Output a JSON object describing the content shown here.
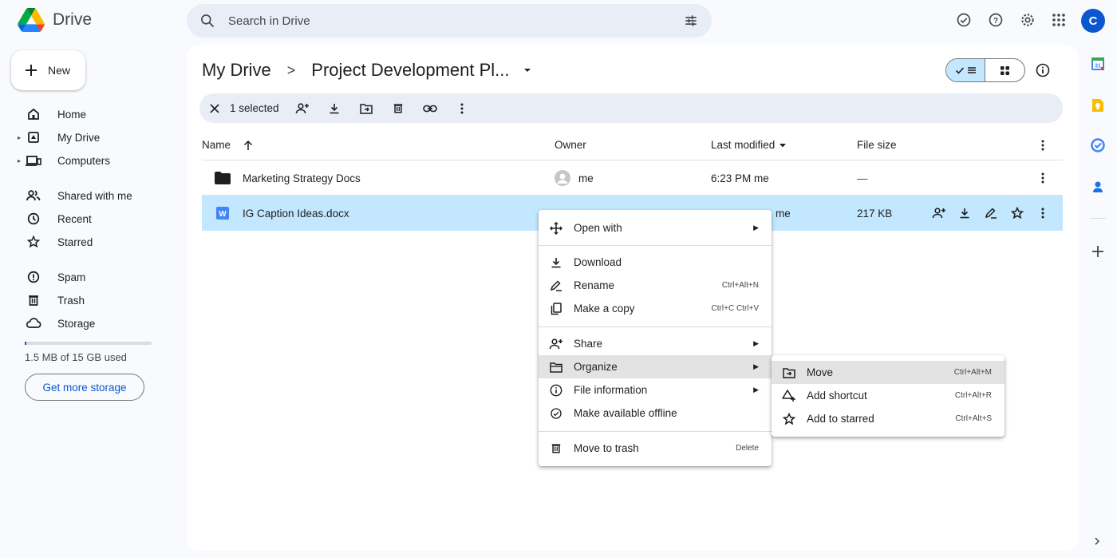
{
  "app": {
    "name": "Drive"
  },
  "search": {
    "placeholder": "Search in Drive"
  },
  "sidebar": {
    "new_label": "New",
    "items": [
      {
        "label": "Home",
        "icon": "home-icon"
      },
      {
        "label": "My Drive",
        "icon": "my-drive-icon"
      },
      {
        "label": "Computers",
        "icon": "computers-icon"
      },
      {
        "label": "Shared with me",
        "icon": "shared-icon"
      },
      {
        "label": "Recent",
        "icon": "clock-icon"
      },
      {
        "label": "Starred",
        "icon": "star-icon"
      },
      {
        "label": "Spam",
        "icon": "spam-icon"
      },
      {
        "label": "Trash",
        "icon": "trash-icon"
      },
      {
        "label": "Storage",
        "icon": "cloud-icon"
      }
    ],
    "storage_used": "1.5 MB of 15 GB used",
    "storage_fraction": 0.0001,
    "get_storage_label": "Get more storage"
  },
  "breadcrumb": {
    "root": "My Drive",
    "separator": ">",
    "current": "Project Development Pl..."
  },
  "selection": {
    "label": "1 selected"
  },
  "table": {
    "columns": {
      "name": "Name",
      "owner": "Owner",
      "modified": "Last modified",
      "size": "File size"
    },
    "rows": [
      {
        "name": "Marketing Strategy Docs",
        "owner": "me",
        "modified": "6:23 PM me",
        "size": "—",
        "type": "folder",
        "selected": false
      },
      {
        "name": "IG Caption Ideas.docx",
        "owner": "",
        "modified": "me",
        "size": "217 KB",
        "type": "docx",
        "selected": true
      }
    ]
  },
  "context_menu": {
    "items": [
      {
        "label": "Open with",
        "icon": "open-with-icon",
        "shortcut": "",
        "submenu": true
      },
      {
        "label": "Download",
        "icon": "download-icon",
        "shortcut": "",
        "submenu": false
      },
      {
        "label": "Rename",
        "icon": "rename-icon",
        "shortcut": "Ctrl+Alt+N",
        "submenu": false
      },
      {
        "label": "Make a copy",
        "icon": "copy-icon",
        "shortcut": "Ctrl+C Ctrl+V",
        "submenu": false
      },
      {
        "label": "Share",
        "icon": "share-icon",
        "shortcut": "",
        "submenu": true
      },
      {
        "label": "Organize",
        "icon": "organize-icon",
        "shortcut": "",
        "submenu": true
      },
      {
        "label": "File information",
        "icon": "info-icon",
        "shortcut": "",
        "submenu": true
      },
      {
        "label": "Make available offline",
        "icon": "offline-icon",
        "shortcut": "",
        "submenu": false
      },
      {
        "label": "Move to trash",
        "icon": "trash-icon",
        "shortcut": "Delete",
        "submenu": false
      }
    ]
  },
  "organize_submenu": {
    "items": [
      {
        "label": "Move",
        "shortcut": "Ctrl+Alt+M"
      },
      {
        "label": "Add shortcut",
        "shortcut": "Ctrl+Alt+R"
      },
      {
        "label": "Add to starred",
        "shortcut": "Ctrl+Alt+S"
      }
    ]
  },
  "user": {
    "initial": "C"
  },
  "colors": {
    "accent": "#0b57d0",
    "selected_row": "#c2e7ff",
    "background": "#f8fafd"
  }
}
